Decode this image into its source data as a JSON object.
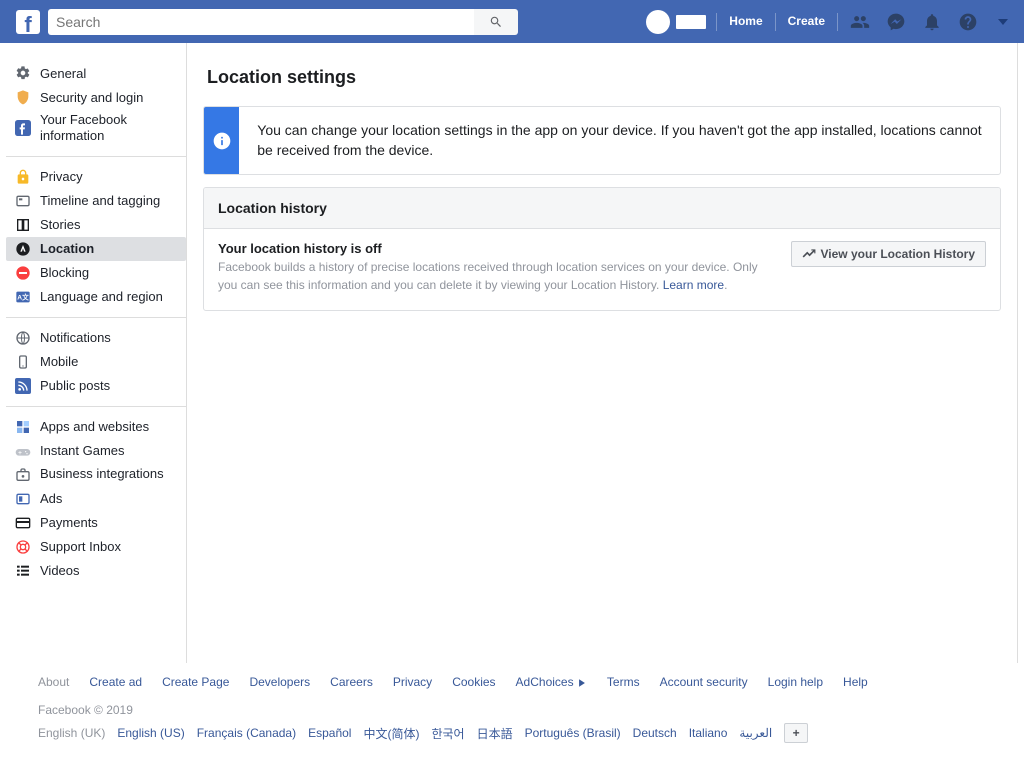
{
  "topbar": {
    "search_placeholder": "Search",
    "nav": {
      "home": "Home",
      "create": "Create"
    }
  },
  "sidebar": {
    "groups": [
      {
        "items": [
          {
            "label": "General",
            "icon": "gear",
            "color": "#616770"
          },
          {
            "label": "Security and login",
            "icon": "shield",
            "color": "#f0ad4e"
          },
          {
            "label": "Your Facebook information",
            "icon": "fb-square",
            "color": "#4267b2"
          }
        ]
      },
      {
        "items": [
          {
            "label": "Privacy",
            "icon": "lock",
            "color": "#f7b928"
          },
          {
            "label": "Timeline and tagging",
            "icon": "timeline",
            "color": "#616770"
          },
          {
            "label": "Stories",
            "icon": "book",
            "color": "#1c1e21"
          },
          {
            "label": "Location",
            "icon": "location-a",
            "color": "#1c1e21",
            "active": true
          },
          {
            "label": "Blocking",
            "icon": "minus-circle",
            "color": "#fa3e3e"
          },
          {
            "label": "Language and region",
            "icon": "language",
            "color": "#4267b2"
          }
        ]
      },
      {
        "items": [
          {
            "label": "Notifications",
            "icon": "globe",
            "color": "#616770"
          },
          {
            "label": "Mobile",
            "icon": "mobile",
            "color": "#616770"
          },
          {
            "label": "Public posts",
            "icon": "rss",
            "color": "#4267b2"
          }
        ]
      },
      {
        "items": [
          {
            "label": "Apps and websites",
            "icon": "apps",
            "color": "#4267b2"
          },
          {
            "label": "Instant Games",
            "icon": "gamepad",
            "color": "#bec2c9"
          },
          {
            "label": "Business integrations",
            "icon": "briefcase-gear",
            "color": "#616770"
          },
          {
            "label": "Ads",
            "icon": "ad",
            "color": "#4267b2"
          },
          {
            "label": "Payments",
            "icon": "credit-card",
            "color": "#1c1e21"
          },
          {
            "label": "Support Inbox",
            "icon": "life-ring",
            "color": "#fa3e3e"
          },
          {
            "label": "Videos",
            "icon": "video-list",
            "color": "#1c1e21"
          }
        ]
      }
    ]
  },
  "page": {
    "title": "Location settings",
    "info_text": "You can change your location settings in the app on your device. If you haven't got the app installed, locations cannot be received from the device.",
    "history": {
      "header": "Location history",
      "title": "Your location history is off",
      "desc": "Facebook builds a history of precise locations received through location services on your device. Only you can see this information and you can delete it by viewing your Location History. ",
      "learn_more": "Learn more",
      "button": "View your Location History"
    }
  },
  "footer": {
    "links": [
      "About",
      "Create ad",
      "Create Page",
      "Developers",
      "Careers",
      "Privacy",
      "Cookies",
      "AdChoices",
      "Terms",
      "Account security",
      "Login help",
      "Help"
    ],
    "copyright": "Facebook © 2019",
    "current_lang": "English (UK)",
    "languages": [
      "English (US)",
      "Français (Canada)",
      "Español",
      "中文(简体)",
      "한국어",
      "日本語",
      "Português (Brasil)",
      "Deutsch",
      "Italiano",
      "العربية"
    ]
  }
}
